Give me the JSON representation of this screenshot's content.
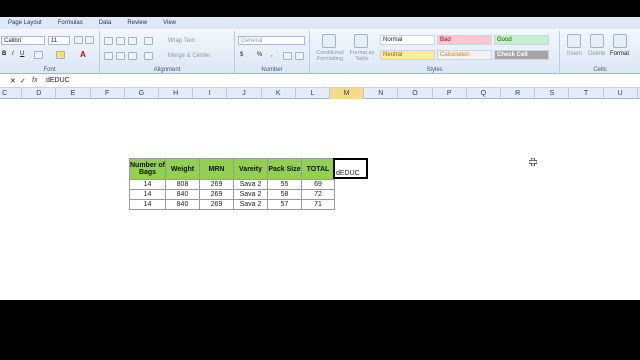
{
  "tabs": [
    "Page Layout",
    "Formulas",
    "Data",
    "Review",
    "View"
  ],
  "font": {
    "name": "Calibri",
    "size": "11",
    "group_label": "Font"
  },
  "alignment": {
    "wrap_text": "Wrap Text",
    "merge_center": "Merge & Center",
    "group_label": "Alignment"
  },
  "number": {
    "format": "General",
    "group_label": "Number"
  },
  "styles": {
    "conditional_formatting": "Conditional Formatting",
    "format_as_table": "Format as Table",
    "normal": "Normal",
    "bad": "Bad",
    "good": "Good",
    "neutral": "Neutral",
    "calculation": "Calculation",
    "check_cell": "Check Cell",
    "group_label": "Styles"
  },
  "cells": {
    "insert": "Insert",
    "delete": "Delete",
    "format": "Format",
    "group_label": "Cells"
  },
  "formula_bar": {
    "name_box": "",
    "fx": "fx",
    "content": "dEDUC"
  },
  "columns": [
    "C",
    "D",
    "E",
    "F",
    "G",
    "H",
    "I",
    "J",
    "K",
    "L",
    "M",
    "N",
    "O",
    "P",
    "Q",
    "R",
    "S",
    "T",
    "U"
  ],
  "selected_column": "M",
  "table": {
    "headers": [
      "Number of Bags",
      "Weight",
      "MRN",
      "Vareity",
      "Pack Size",
      "TOTAL"
    ],
    "rows": [
      [
        "14",
        "808",
        "269",
        "Sava 2",
        "55",
        "69"
      ],
      [
        "14",
        "840",
        "269",
        "Sava 2",
        "58",
        "72"
      ],
      [
        "14",
        "840",
        "269",
        "Sava 2",
        "57",
        "71"
      ]
    ]
  },
  "active_cell_text": "dEDUC",
  "colors": {
    "header_fill": "#92d050",
    "ribbon": "#dbe7f4"
  }
}
